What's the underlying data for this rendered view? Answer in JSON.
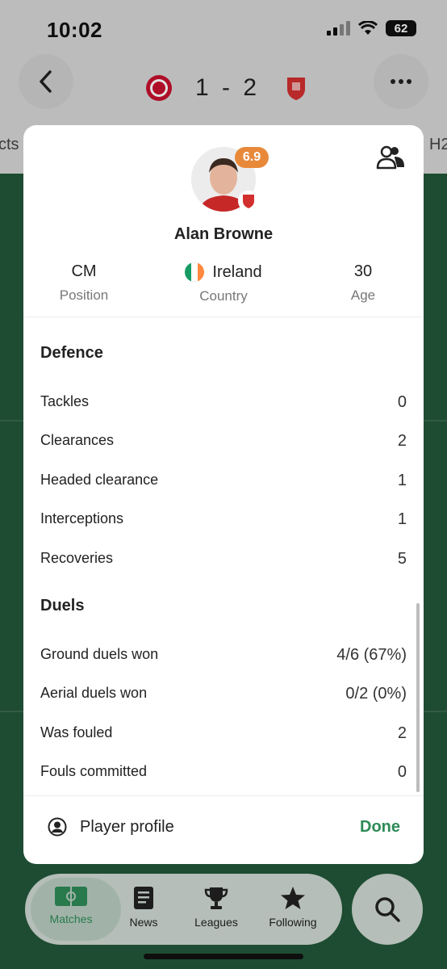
{
  "status": {
    "time": "10:02",
    "battery": "62"
  },
  "match": {
    "score": "1 - 2",
    "left_tab_peek": "cts",
    "right_tab_peek": "H2"
  },
  "player": {
    "name": "Alan Browne",
    "rating": "6.9",
    "info": [
      {
        "value": "CM",
        "label": "Position"
      },
      {
        "value": "Ireland",
        "label": "Country"
      },
      {
        "value": "30",
        "label": "Age"
      }
    ]
  },
  "sections": [
    {
      "title": "Defence",
      "rows": [
        {
          "label": "Tackles",
          "value": "0"
        },
        {
          "label": "Clearances",
          "value": "2"
        },
        {
          "label": "Headed clearance",
          "value": "1"
        },
        {
          "label": "Interceptions",
          "value": "1"
        },
        {
          "label": "Recoveries",
          "value": "5"
        }
      ]
    },
    {
      "title": "Duels",
      "rows": [
        {
          "label": "Ground duels won",
          "value": "4/6 (67%)"
        },
        {
          "label": "Aerial duels won",
          "value": "0/2 (0%)"
        },
        {
          "label": "Was fouled",
          "value": "2"
        },
        {
          "label": "Fouls committed",
          "value": "0"
        }
      ]
    }
  ],
  "footer": {
    "profile_label": "Player profile",
    "done_label": "Done"
  },
  "nav": {
    "items": [
      "Matches",
      "News",
      "Leagues",
      "Following"
    ]
  },
  "colors": {
    "accent": "#2e8b57",
    "rating": "#e8893a"
  },
  "icons": {
    "back": "chevron-left-icon",
    "more": "more-icon",
    "people": "person-group-icon",
    "search": "search-icon"
  }
}
